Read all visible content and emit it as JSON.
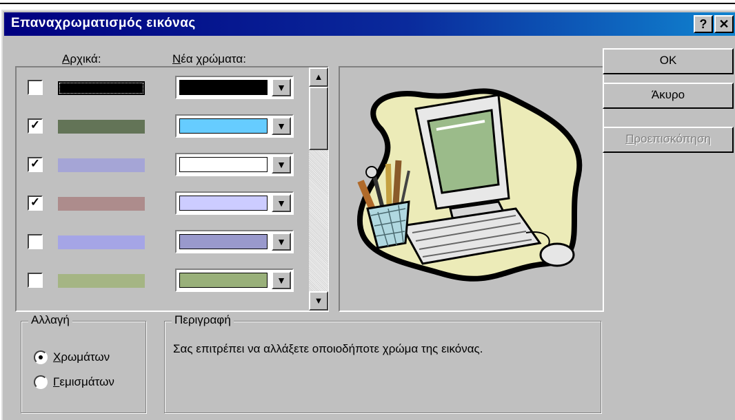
{
  "dialog": {
    "title": "Επαναχρωματισμός εικόνας",
    "help_button": "?",
    "close_button": "✕"
  },
  "columns": {
    "original_label_first": "Α",
    "original_label_rest": "ρχικά:",
    "new_label_first": "Ν",
    "new_label_rest": "έα χρώματα:"
  },
  "rows": [
    {
      "checked": false,
      "check_mark": "",
      "original_color": "#000000",
      "new_color": "#000000",
      "selected": true
    },
    {
      "checked": true,
      "check_mark": "✓",
      "original_color": "#637457",
      "new_color": "#66ccff",
      "selected": false
    },
    {
      "checked": true,
      "check_mark": "✓",
      "original_color": "#a5a5d6",
      "new_color": "#ffffff",
      "selected": false
    },
    {
      "checked": true,
      "check_mark": "✓",
      "original_color": "#ad8c8c",
      "new_color": "#ccccff",
      "selected": false
    },
    {
      "checked": false,
      "check_mark": "",
      "original_color": "#a5a5e6",
      "new_color": "#9999cc",
      "selected": false
    },
    {
      "checked": false,
      "check_mark": "",
      "original_color": "#a5b584",
      "new_color": "#99b07a",
      "selected": false
    }
  ],
  "scrollbar": {
    "up_arrow": "▲",
    "down_arrow": "▼"
  },
  "combo_arrow": "▼",
  "buttons": {
    "ok": "OK",
    "cancel": "Άκυρο",
    "preview_first": "Π",
    "preview_rest": "ροεπισκόπηση"
  },
  "change_group": {
    "legend": "Αλλαγή",
    "colors_first": "Χ",
    "colors_rest": "ρωμάτων",
    "fills_first": "Γ",
    "fills_rest": "εμισμάτων",
    "selected": "colors"
  },
  "description_group": {
    "legend": "Περιγραφή",
    "text": "Σας επιτρέπει να αλλάξετε οποιοδήποτε χρώμα της εικόνας."
  },
  "clipart": {
    "name": "computer-clipart",
    "blob_color": "#ecebb8",
    "monitor_color": "#e8e8e8",
    "screen_color": "#9bbb8a",
    "cup_color": "#b0d8e0"
  }
}
